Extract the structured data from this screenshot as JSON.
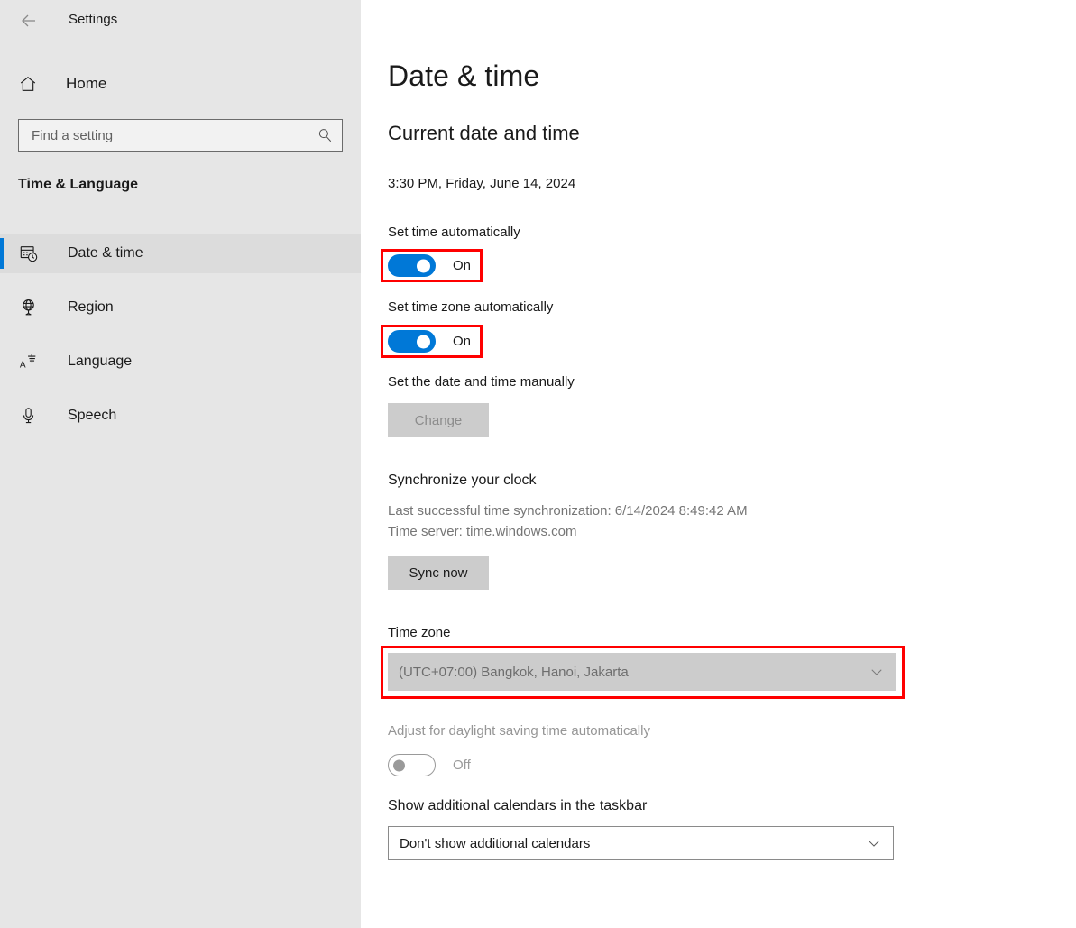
{
  "window": {
    "title": "Settings",
    "back_icon": "back-arrow-icon"
  },
  "sidebar": {
    "home": {
      "label": "Home",
      "icon": "home-icon"
    },
    "search": {
      "value": "",
      "placeholder": "Find a setting",
      "icon": "search-icon"
    },
    "category_title": "Time & Language",
    "items": [
      {
        "label": "Date & time",
        "icon": "calendar-clock-icon",
        "selected": true
      },
      {
        "label": "Region",
        "icon": "globe-icon",
        "selected": false
      },
      {
        "label": "Language",
        "icon": "language-icon",
        "selected": false
      },
      {
        "label": "Speech",
        "icon": "microphone-icon",
        "selected": false
      }
    ]
  },
  "main": {
    "page_title": "Date & time",
    "current_section": {
      "heading": "Current date and time",
      "value": "3:30 PM, Friday, June 14, 2024"
    },
    "set_time_auto": {
      "label": "Set time automatically",
      "state": "On",
      "highlighted": true
    },
    "set_timezone_auto": {
      "label": "Set time zone automatically",
      "state": "On",
      "highlighted": true
    },
    "manual": {
      "label": "Set the date and time manually",
      "button_label": "Change",
      "disabled": true
    },
    "sync": {
      "heading": "Synchronize your clock",
      "last_sync": "Last successful time synchronization: 6/14/2024 8:49:42 AM",
      "time_server": "Time server: time.windows.com",
      "button_label": "Sync now"
    },
    "time_zone": {
      "label": "Time zone",
      "selected": "(UTC+07:00) Bangkok, Hanoi, Jakarta",
      "disabled": true,
      "highlighted": true,
      "chevron_icon": "chevron-down-icon"
    },
    "dst": {
      "label": "Adjust for daylight saving time automatically",
      "state": "Off",
      "disabled": true
    },
    "calendars": {
      "label": "Show additional calendars in the taskbar",
      "selected": "Don't show additional calendars",
      "chevron_icon": "chevron-down-icon"
    }
  },
  "colors": {
    "accent": "#0078d7",
    "highlight": "#ff0000",
    "sidebar_bg": "#e6e6e6",
    "button_bg": "#cccccc"
  }
}
